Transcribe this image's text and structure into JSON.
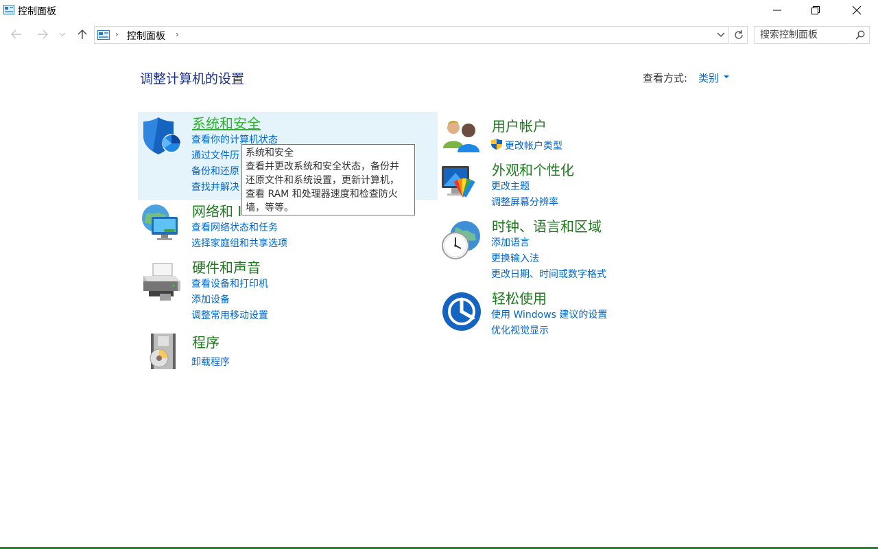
{
  "window": {
    "title": "控制面板",
    "minimize_label": "",
    "maximize_label": "",
    "close_label": ""
  },
  "address": {
    "breadcrumb": [
      "控制面板"
    ],
    "search_placeholder": "搜索控制面板"
  },
  "header": {
    "title": "调整计算机的设置",
    "view_by_label": "查看方式:",
    "view_by_value": "类别"
  },
  "categories": [
    {
      "title": "系统和安全",
      "icon": "shield-icon",
      "links": [
        "查看你的计算机状态",
        "通过文件历",
        "备份和还原",
        "查找并解决"
      ]
    },
    {
      "title": "网络和 I",
      "icon": "network-icon",
      "links": [
        "查看网络状态和任务",
        "选择家庭组和共享选项"
      ]
    },
    {
      "title": "硬件和声音",
      "icon": "printer-icon",
      "links": [
        "查看设备和打印机",
        "添加设备",
        "调整常用移动设置"
      ]
    },
    {
      "title": "程序",
      "icon": "programs-icon",
      "links": [
        "卸载程序"
      ]
    },
    {
      "title": "用户帐户",
      "icon": "users-icon",
      "links": [
        "更改帐户类型"
      ]
    },
    {
      "title": "外观和个性化",
      "icon": "appearance-icon",
      "links": [
        "更改主题",
        "调整屏幕分辨率"
      ]
    },
    {
      "title": "时钟、语言和区域",
      "icon": "clock-globe-icon",
      "links": [
        "添加语言",
        "更换输入法",
        "更改日期、时间或数字格式"
      ]
    },
    {
      "title": "轻松使用",
      "icon": "ease-of-access-icon",
      "links": [
        "使用 Windows 建议的设置",
        "优化视觉显示"
      ]
    }
  ],
  "tooltip": {
    "lines": [
      "系统和安全",
      "查看并更改系统和安全状态，备份并",
      "还原文件和系统设置，更新计算机，",
      "查看 RAM 和处理器速度和检查防火",
      "墙，等等。"
    ]
  },
  "colors": {
    "category_title": "#1e7a1e",
    "link": "#0066cc",
    "page_title": "#1e3287",
    "hover_bg": "#e5f3fb"
  }
}
